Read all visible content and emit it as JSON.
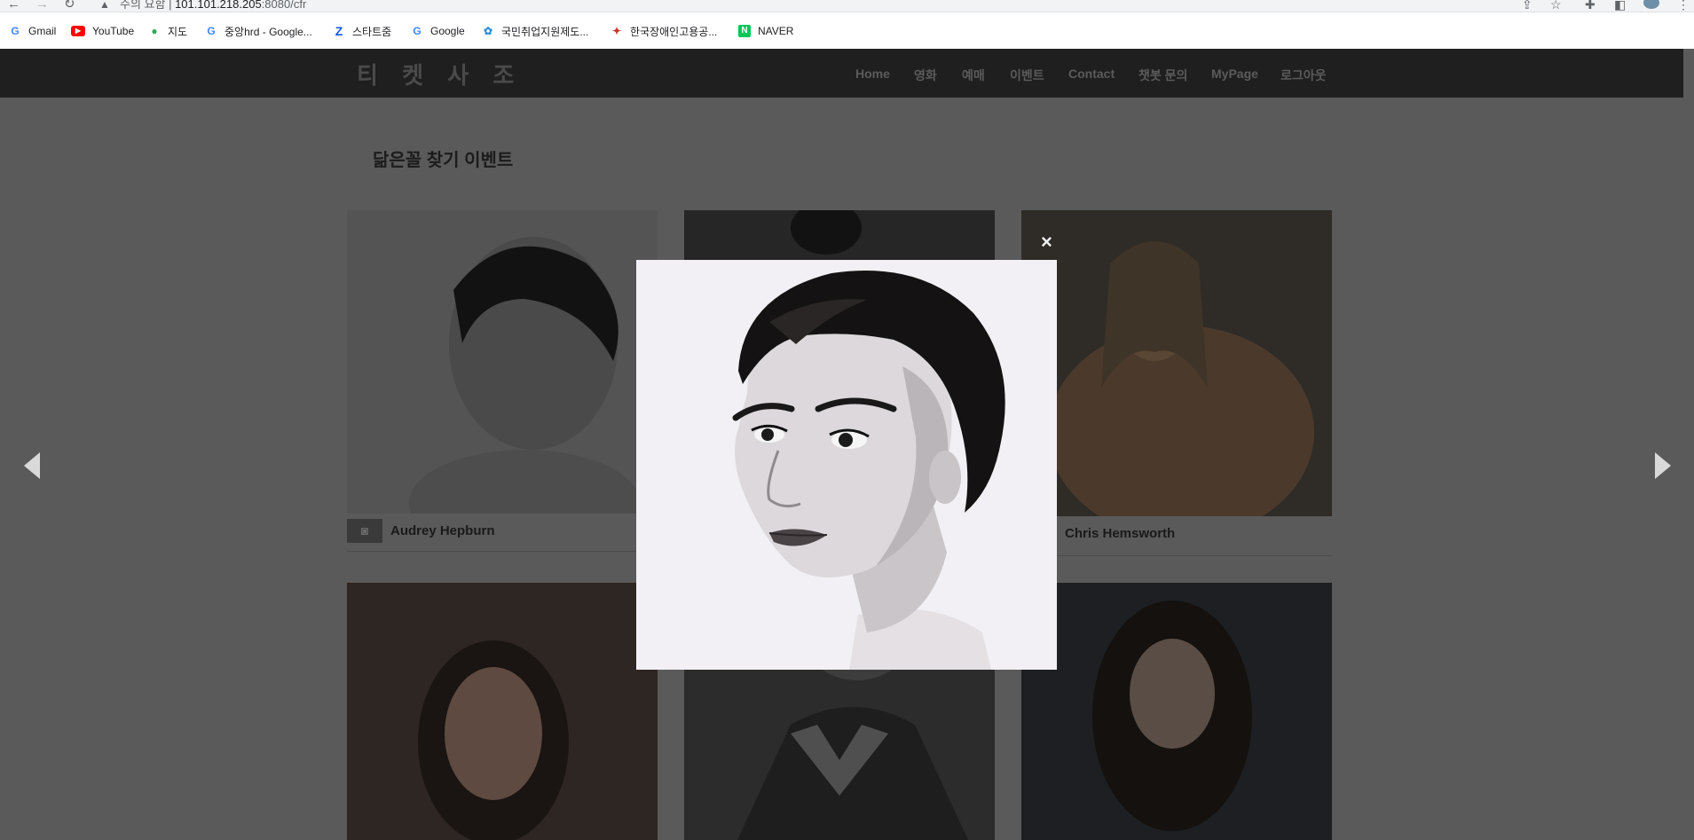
{
  "browser": {
    "security_label": "주의 요함",
    "url_host": "101.101.218.205",
    "url_path": ":8080/cfr",
    "bookmarks": [
      {
        "label": "Gmail",
        "icon": "google-icon"
      },
      {
        "label": "YouTube",
        "icon": "youtube-icon"
      },
      {
        "label": "지도",
        "icon": "maps-icon"
      },
      {
        "label": "중앙hrd - Google...",
        "icon": "google-icon"
      },
      {
        "label": "스타트줌",
        "icon": "z-icon"
      },
      {
        "label": "Google",
        "icon": "google-icon"
      },
      {
        "label": "국민취업지원제도...",
        "icon": "site-icon"
      },
      {
        "label": "한국장애인고용공...",
        "icon": "site-icon"
      },
      {
        "label": "NAVER",
        "icon": "naver-icon"
      }
    ]
  },
  "header": {
    "logo": "티 켓 사 조",
    "menu": [
      "Home",
      "영화",
      "예매",
      "이벤트",
      "Contact",
      "챗봇 문의",
      "MyPage",
      "로그아웃"
    ]
  },
  "page": {
    "title": "닮은꼴 찾기 이벤트"
  },
  "gallery": {
    "cards": [
      {
        "name": "Audrey Hepburn"
      },
      {
        "name": ""
      },
      {
        "name": "Chris Hemsworth"
      },
      {
        "name": ""
      },
      {
        "name": ""
      },
      {
        "name": ""
      }
    ]
  },
  "modal": {
    "close_symbol": "×"
  },
  "colors": {
    "overlay": "#5a5a5a",
    "header": "#1f1f1f",
    "modal_bg": "#f4f1f6"
  }
}
